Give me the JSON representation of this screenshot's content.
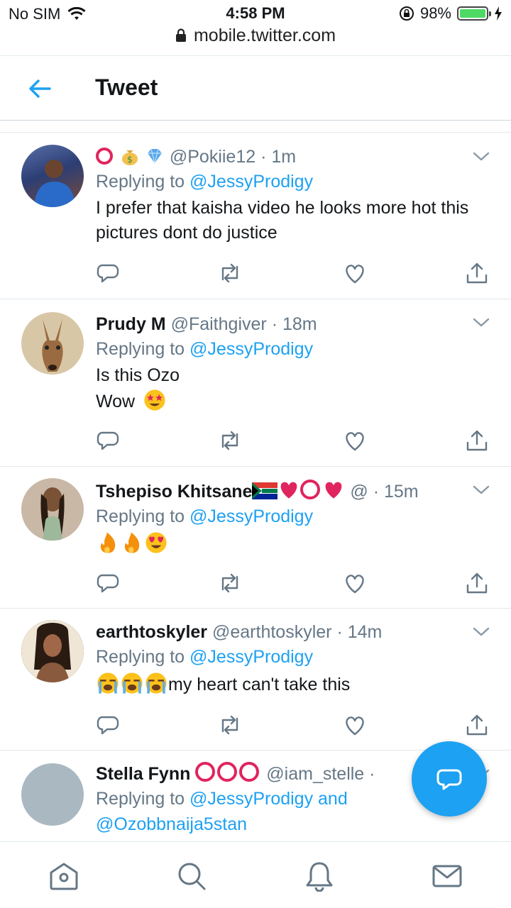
{
  "status_bar": {
    "carrier": "No SIM",
    "time": "4:58 PM",
    "battery": "98%",
    "battery_level": 0.98
  },
  "browser": {
    "url": "mobile.twitter.com"
  },
  "header": {
    "title": "Tweet",
    "back_icon": "arrow-left-icon"
  },
  "tweets": [
    {
      "name": "",
      "handle": "@Pokiie12",
      "time": "· 1m",
      "replying_label": "Replying to",
      "mentions": "@JessyProdigy",
      "text": "I prefer that kaisha video he looks more hot this pictures dont do justice"
    },
    {
      "name": "Prudy M",
      "handle": "@Faithgiver",
      "time": "· 18m",
      "replying_label": "Replying to",
      "mentions": "@JessyProdigy",
      "text_line1": "Is this Ozo",
      "text_line2": "Wow"
    },
    {
      "name": "Tshepiso Khitsane",
      "handle": "@",
      "time": "· 15m",
      "replying_label": "Replying to",
      "mentions": "@JessyProdigy",
      "text": ""
    },
    {
      "name": "earthtoskyler",
      "handle": "@earthtoskyler",
      "time": "· 14m",
      "replying_label": "Replying to",
      "mentions": "@JessyProdigy",
      "text": "my heart can't take this"
    },
    {
      "name": "Stella Fynn",
      "handle": "@iam_stelle",
      "time": "·",
      "replying_label": "Replying to",
      "mentions": "@JessyProdigy and",
      "mentions_line2": "@Ozobbnaija5stan"
    }
  ],
  "colors": {
    "accent": "#1da1f2",
    "heart_red": "#e0245e",
    "secondary_text": "#657786"
  },
  "nav": [
    "home-icon",
    "search-icon",
    "notifications-icon",
    "messages-icon"
  ]
}
